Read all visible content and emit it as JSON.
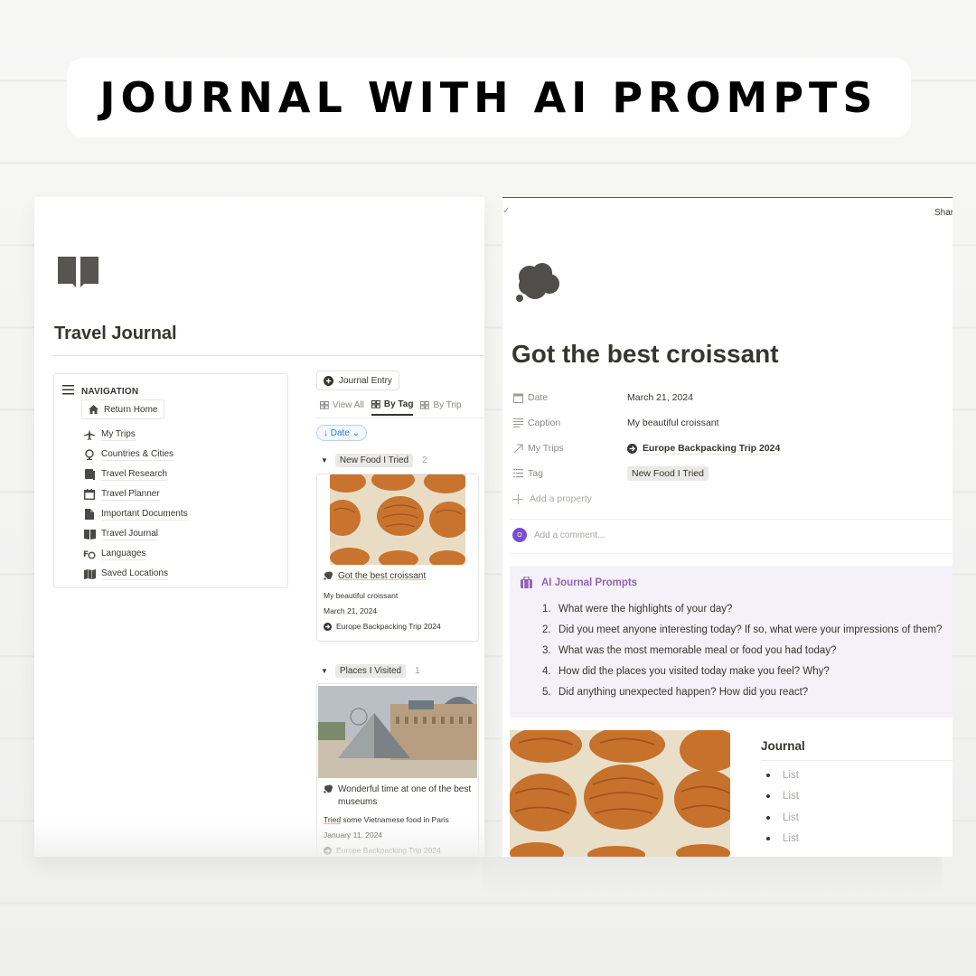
{
  "banner": {
    "title": "JOURNAL WITH AI PROMPTS"
  },
  "left": {
    "page_icon": "book-open-icon",
    "title": "Travel Journal",
    "navigation": {
      "header": "NAVIGATION",
      "return_home": "Return Home",
      "items": [
        {
          "label": "My Trips",
          "icon": "airplane-icon"
        },
        {
          "label": "Countries & Cities",
          "icon": "globe-icon"
        },
        {
          "label": "Travel Research",
          "icon": "book-icon"
        },
        {
          "label": "Travel Planner",
          "icon": "calendar-icon"
        },
        {
          "label": "Important Documents",
          "icon": "document-icon"
        },
        {
          "label": "Travel Journal",
          "icon": "book-open-icon"
        },
        {
          "label": "Languages",
          "icon": "translate-icon"
        },
        {
          "label": "Saved Locations",
          "icon": "map-icon"
        }
      ]
    },
    "new_button": "Journal Entry",
    "tabs": [
      {
        "label": "View All",
        "active": false
      },
      {
        "label": "By Tag",
        "active": true
      },
      {
        "label": "By Trip",
        "active": false
      }
    ],
    "sort": {
      "label": "↓ Date ⌄"
    },
    "groups": [
      {
        "tag": "New Food I Tried",
        "count": "2",
        "card": {
          "title": "Got the best croissant",
          "caption": "My beautiful croissant",
          "date": "March 21, 2024",
          "trip": "Europe Backpacking Trip 2024"
        }
      },
      {
        "tag": "Places I Visited",
        "count": "1",
        "card": {
          "title": "Wonderful time at one of the best museums",
          "caption_a": "Tried",
          "caption_b": " some Vietnamese food in Paris",
          "date": "January 11, 2024",
          "trip": "Europe Backpacking Trip 2024"
        }
      }
    ]
  },
  "right": {
    "share_label": "Share",
    "check": "✓",
    "page_icon": "thought-cloud-icon",
    "title": "Got the best croissant",
    "properties": [
      {
        "name": "Date",
        "value": "March 21, 2024",
        "icon": "calendar-icon"
      },
      {
        "name": "Caption",
        "value": "My beautiful croissant",
        "icon": "text-lines-icon"
      },
      {
        "name": "My Trips",
        "value": "Europe Backpacking Trip 2024",
        "icon": "arrow-up-right-icon"
      },
      {
        "name": "Tag",
        "value": "New Food I Tried",
        "icon": "list-icon"
      }
    ],
    "add_property": "Add a property",
    "comment": {
      "avatar_initial": "O",
      "placeholder": "Add a comment..."
    },
    "callout": {
      "title": "AI Journal Prompts",
      "prompts": [
        {
          "num": "1.",
          "text": "What were the highlights of your day?"
        },
        {
          "num": "2.",
          "text": "Did you meet anyone interesting today? If so, what were your impressions of them?"
        },
        {
          "num": "3.",
          "text": "What was the most memorable meal or food you had today?"
        },
        {
          "num": "4.",
          "text": "How did the places you visited today make you feel? Why?"
        },
        {
          "num": "5.",
          "text": "Did anything unexpected happen? How did you react?"
        }
      ]
    },
    "journal": {
      "heading": "Journal",
      "items": [
        "List",
        "List",
        "List",
        "List"
      ]
    }
  },
  "colors": {
    "text": "#37352f",
    "muted": "#8a8986",
    "callout_bg": "#f5f1f9",
    "callout_accent": "#9065b0",
    "avatar": "#7b4fc9",
    "sort_blue": "#2e7cd1"
  }
}
